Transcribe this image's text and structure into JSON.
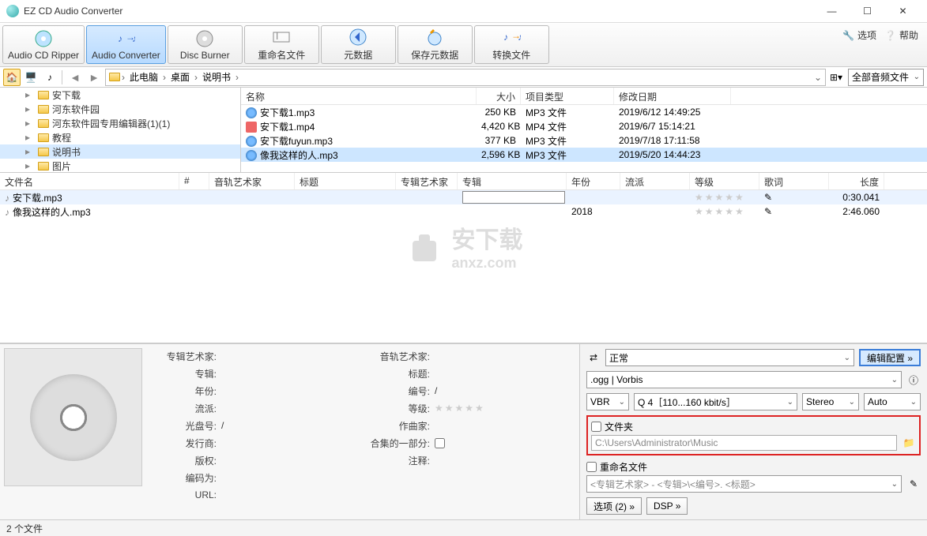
{
  "app": {
    "title": "EZ CD Audio Converter"
  },
  "window": {
    "min": "—",
    "max": "☐",
    "close": "✕"
  },
  "toolbar": {
    "audio_cd_ripper": "Audio CD Ripper",
    "audio_converter": "Audio Converter",
    "disc_burner": "Disc Burner",
    "rename_files": "重命名文件",
    "metadata": "元数据",
    "save_metadata": "保存元数据",
    "convert_files": "转换文件",
    "options": "选项",
    "help": "帮助"
  },
  "breadcrumb": {
    "items": [
      "此电脑",
      "桌面",
      "说明书"
    ],
    "filter": "全部音频文件"
  },
  "tree": {
    "items": [
      {
        "label": "安下载",
        "selected": false
      },
      {
        "label": "河东软件园",
        "selected": false
      },
      {
        "label": "河东软件园专用编辑器(1)(1)",
        "selected": false
      },
      {
        "label": "教程",
        "selected": false
      },
      {
        "label": "说明书",
        "selected": true
      },
      {
        "label": "图片",
        "selected": false
      }
    ]
  },
  "file_columns": {
    "name": "名称",
    "size": "大小",
    "type": "项目类型",
    "date": "修改日期"
  },
  "files": [
    {
      "name": "安下载1.mp3",
      "size": "250 KB",
      "type": "MP3 文件",
      "date": "2019/6/12 14:49:25",
      "icon": "mp3",
      "selected": false
    },
    {
      "name": "安下载1.mp4",
      "size": "4,420 KB",
      "type": "MP4 文件",
      "date": "2019/6/7 15:14:21",
      "icon": "mp4",
      "selected": false
    },
    {
      "name": "安下载fuyun.mp3",
      "size": "377 KB",
      "type": "MP3 文件",
      "date": "2019/7/18 17:11:58",
      "icon": "mp3",
      "selected": false
    },
    {
      "name": "像我这样的人.mp3",
      "size": "2,596 KB",
      "type": "MP3 文件",
      "date": "2019/5/20 14:44:23",
      "icon": "mp3",
      "selected": true
    }
  ],
  "queue_columns": {
    "name": "文件名",
    "num": "#",
    "artist": "音轨艺术家",
    "title": "标题",
    "aartist": "专辑艺术家",
    "album": "专辑",
    "year": "年份",
    "genre": "流派",
    "rating": "等级",
    "lyric": "歌词",
    "len": "长度"
  },
  "queue": [
    {
      "name": "安下载.mp3",
      "year": "",
      "len": "0:30.041",
      "selected": true
    },
    {
      "name": "像我这样的人.mp3",
      "year": "2018",
      "len": "2:46.060",
      "selected": false
    }
  ],
  "meta_labels": {
    "album_artist": "专辑艺术家:",
    "album": "专辑:",
    "year": "年份:",
    "genre": "流派:",
    "disc_no": "光盘号:",
    "publisher": "发行商:",
    "copyright": "版权:",
    "encoder": "编码为:",
    "url": "URL:",
    "track_artist": "音轨艺术家:",
    "title": "标题:",
    "track_no": "编号:",
    "rating": "等级:",
    "composer": "作曲家:",
    "part_of_set": "合集的一部分:",
    "comment": "注释:"
  },
  "meta_vals": {
    "slash": "/"
  },
  "settings": {
    "mode": "正常",
    "edit_config": "编辑配置 »",
    "format": ".ogg | Vorbis",
    "vbr": "VBR",
    "quality": "Q 4［110...160 kbit/s］",
    "stereo": "Stereo",
    "auto": "Auto",
    "folder_section": "文件夹",
    "folder_path": "C:\\Users\\Administrator\\Music",
    "rename_section": "重命名文件",
    "rename_pattern": "<专辑艺术家> - <专辑>\\<编号>. <标题>",
    "options_btn": "选项 (2) »",
    "dsp_btn": "DSP »"
  },
  "status": {
    "text": "2 个文件"
  },
  "watermark": {
    "cn": "安下载",
    "en": "anxz.com"
  }
}
